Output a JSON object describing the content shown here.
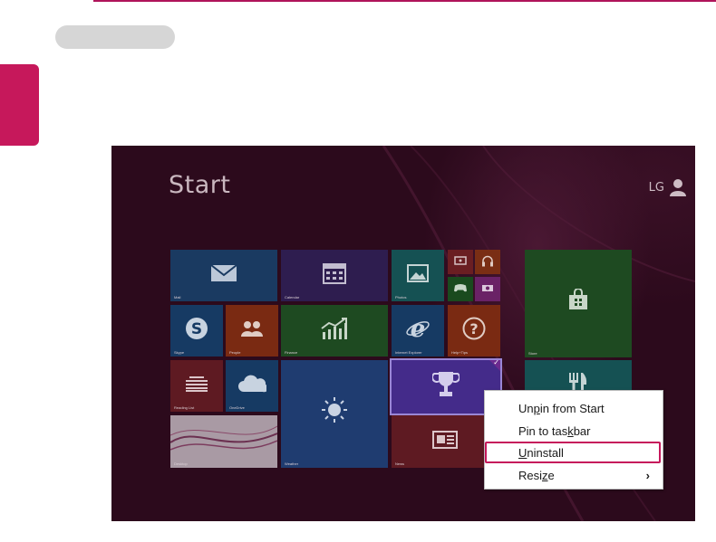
{
  "start": {
    "title": "Start"
  },
  "user": {
    "name": "LG"
  },
  "tiles": {
    "mail": "Mail",
    "calendar": "Calendar",
    "photos": "Photos",
    "store": "Store",
    "skype": "Skype",
    "people": "People",
    "finance": "Finance",
    "ie": "Internet Explorer",
    "help": "Help+Tips",
    "reading": "Reading List",
    "onedrive": "OneDrive",
    "weather": "Weather",
    "desktop": "Desktop",
    "news": "News",
    "food": "Food & Drink"
  },
  "context_menu": {
    "items": [
      {
        "pre": "Un",
        "ul": "p",
        "post": "in from Start"
      },
      {
        "pre": "Pin to tas",
        "ul": "k",
        "post": "bar"
      },
      {
        "pre": "",
        "ul": "U",
        "post": "ninstall"
      },
      {
        "pre": "Resi",
        "ul": "z",
        "post": "e"
      }
    ],
    "submenu_arrow": "›"
  },
  "colors": {
    "accent": "#c6185b",
    "screen_bg": "#2c0a1c"
  }
}
